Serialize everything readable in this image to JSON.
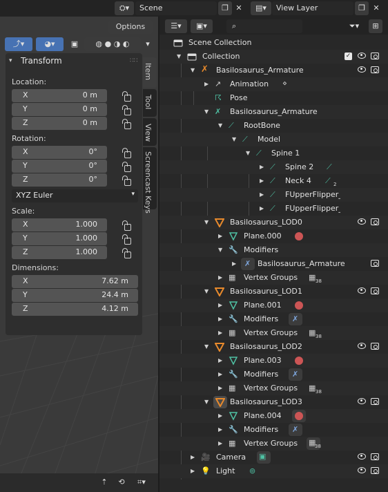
{
  "topbar": {
    "scene": "Scene",
    "view_layer": "View Layer"
  },
  "viewport": {
    "options_label": "Options"
  },
  "npanel": {
    "panel_title": "Transform",
    "tabs": [
      "Item",
      "Tool",
      "View",
      "Screencast Keys"
    ],
    "location": {
      "label": "Location:",
      "x": "0 m",
      "y": "0 m",
      "z": "0 m"
    },
    "rotation": {
      "label": "Rotation:",
      "x": "0°",
      "y": "0°",
      "z": "0°"
    },
    "rotation_mode": "XYZ Euler",
    "scale": {
      "label": "Scale:",
      "x": "1.000",
      "y": "1.000",
      "z": "1.000"
    },
    "dimensions": {
      "label": "Dimensions:",
      "x": "7.62 m",
      "y": "24.4 m",
      "z": "4.12 m"
    },
    "axes": {
      "x": "X",
      "y": "Y",
      "z": "Z"
    }
  },
  "outliner": {
    "scene_collection": "Scene Collection",
    "collection": "Collection",
    "armature": "Basilosaurus_Armature",
    "animation": "Animation",
    "pose": "Pose",
    "armature_data": "Basilosaurus_Armature",
    "root_bone": "RootBone",
    "model": "Model",
    "spine1": "Spine 1",
    "spine2": "Spine 2",
    "neck4": "Neck 4",
    "neck4_count": "2",
    "flipper_l": "FUpperFlipper_L",
    "flipper_r": "FUpperFlipper_R",
    "lod0": "Basilosaurus_LOD0",
    "lod0_mesh": "Plane.000",
    "lod1": "Basilosaurus_LOD1",
    "lod1_mesh": "Plane.001",
    "lod2": "Basilosaurus_LOD2",
    "lod2_mesh": "Plane.003",
    "lod3": "Basilosaurus_LOD3",
    "lod3_mesh": "Plane.004",
    "modifiers": "Modifiers",
    "armature_modifier": "Basilosaurus_Armature",
    "vertex_groups": "Vertex Groups",
    "vg_count": "38",
    "camera": "Camera",
    "light": "Light"
  },
  "colors": {
    "accent_blue": "#4772b3",
    "bone_green": "#4fc1a4",
    "mesh_orange": "#e88a2c",
    "mesh_green": "#4fc1a4",
    "material_red": "#c55"
  }
}
